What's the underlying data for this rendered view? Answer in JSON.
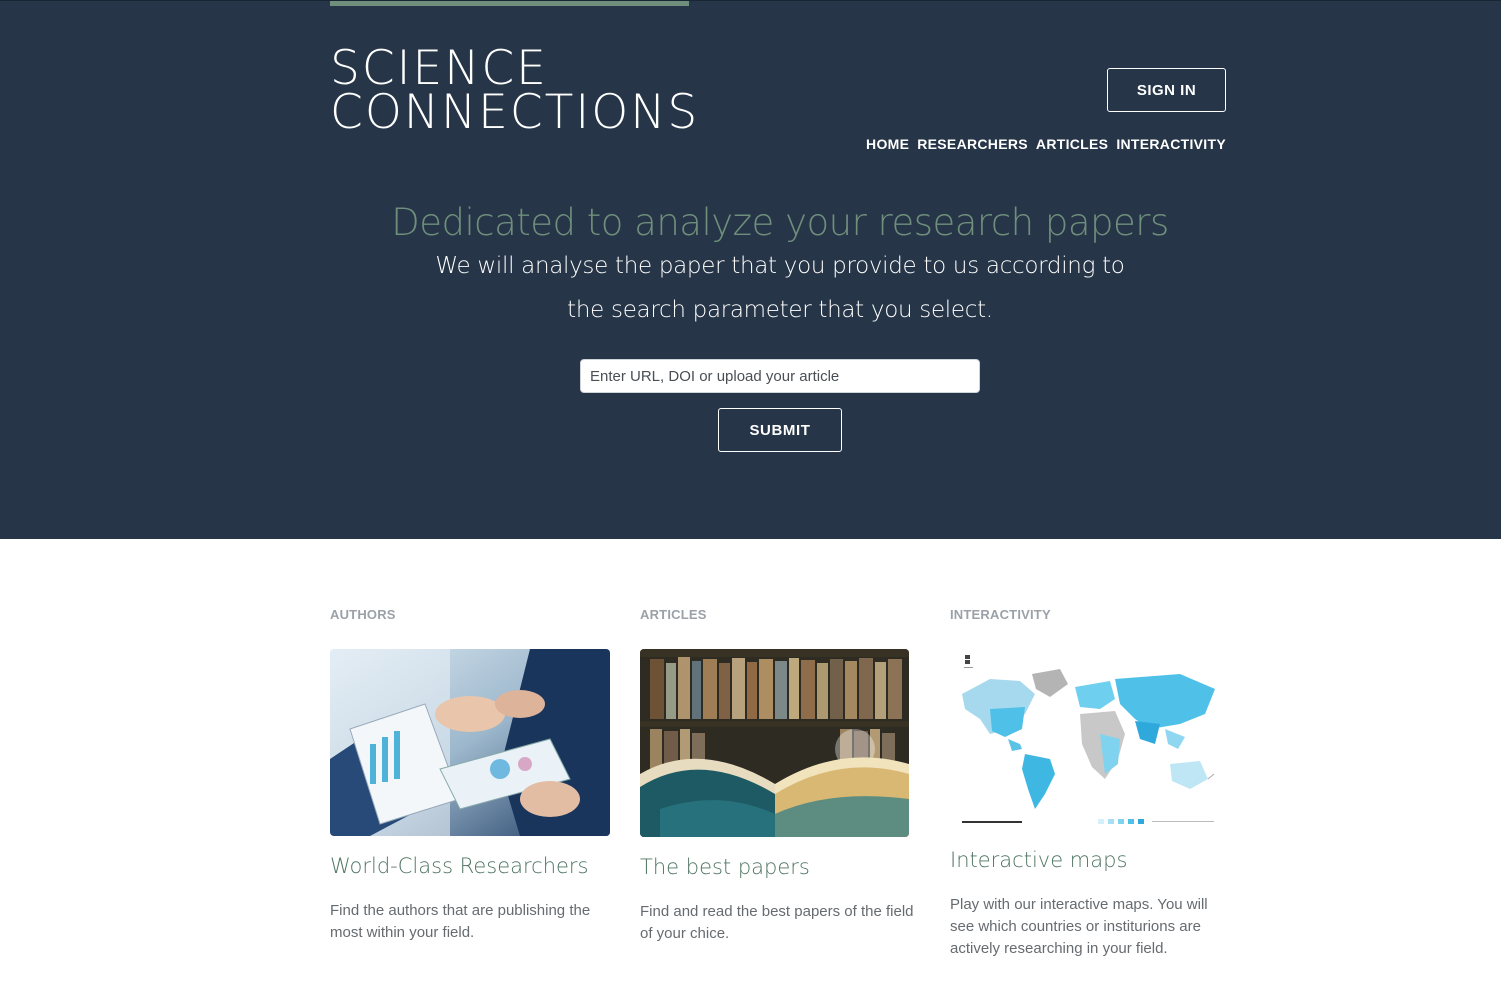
{
  "brand": {
    "line1": "SCIENCE",
    "line2": "CONNECTIONS"
  },
  "header": {
    "signin_label": "SIGN IN",
    "nav": [
      "HOME",
      "RESEARCHERS",
      "ARTICLES",
      "INTERACTIVITY"
    ]
  },
  "hero": {
    "headline": "Dedicated to analyze your research papers",
    "subline": "We will analyse the paper that you provide to us according to the search parameter that you select.",
    "search_placeholder": "Enter URL, DOI or upload your article",
    "submit_label": "SUBMIT"
  },
  "colors": {
    "hero_bg": "#263547",
    "accent": "#6f8e7c",
    "title": "#4f7462"
  },
  "features": [
    {
      "label": "AUTHORS",
      "title": "World-Class Researchers",
      "desc": "Find the authors that are publishing the most within your field.",
      "image": "business-meeting-photo"
    },
    {
      "label": "ARTICLES",
      "title": "The best papers",
      "desc": "Find and read the best papers of the field of your chice.",
      "image": "open-book-photo"
    },
    {
      "label": "INTERACTIVITY",
      "title": "Interactive maps",
      "desc": "Play with our interactive maps. You will see which countries or institurions are actively researching in your field.",
      "image": "world-map-image"
    }
  ]
}
